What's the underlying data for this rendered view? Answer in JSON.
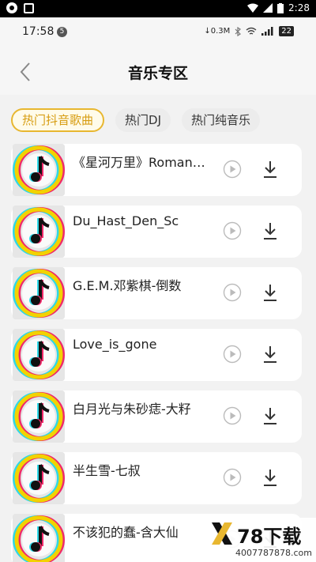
{
  "system_bar": {
    "time": "2:28"
  },
  "phone_status": {
    "time": "17:58",
    "badge": "5",
    "net_speed": "0.3M",
    "signal_label": "22"
  },
  "nav": {
    "title": "音乐专区"
  },
  "tabs": [
    {
      "label": "热门抖音歌曲",
      "active": true
    },
    {
      "label": "热门DJ",
      "active": false
    },
    {
      "label": "热门纯音乐",
      "active": false
    }
  ],
  "songs": [
    {
      "title": "《星河万里》Romance"
    },
    {
      "title": "Du_Hast_Den_Sc"
    },
    {
      "title": "G.E.M.邓紫棋-倒数"
    },
    {
      "title": "Love_is_gone"
    },
    {
      "title": "白月光与朱砂痣-大籽"
    },
    {
      "title": "半生雪-七叔"
    },
    {
      "title": "不该犯的蠢-含大仙"
    }
  ],
  "icons": {
    "cover": "tiktok-music-note-icon",
    "play": "play-circle-icon",
    "download": "download-icon"
  },
  "colors": {
    "accent": "#e8b730",
    "accent_text": "#d79d12"
  },
  "watermark": {
    "brand": "78下载",
    "url": "4007787878.com"
  }
}
